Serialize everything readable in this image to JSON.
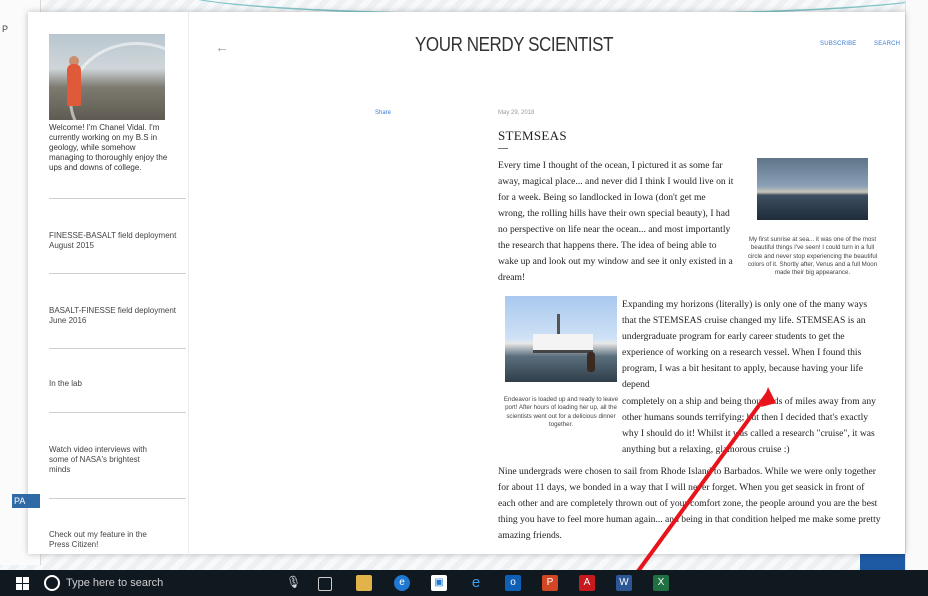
{
  "site": {
    "title": "YOUR NERDY SCIENTIST",
    "back_arrow": "←",
    "subscribe": "SUBSCRIBE",
    "search": "SEARCH"
  },
  "sidebar": {
    "welcome": "Welcome! I'm Chanel Vidal. I'm currently working on my B.S in geology, while somehow managing to thoroughly enjoy the ups and downs of college.",
    "links": [
      "FINESSE-BASALT field deployment August 2015",
      "BASALT-FINESSE field deployment June 2016",
      "In the lab",
      "Watch video interviews with some of NASA's brightest minds",
      "Check out my feature in the Press Citizen!"
    ]
  },
  "post": {
    "share": "Share",
    "date": "May 29, 2018",
    "title": "STEMSEAS",
    "para1": "Every time I thought of the ocean, I pictured it as some far away, magical place... and never did I think I would live on it for a week. Being so landlocked in Iowa (don't get me wrong, the rolling hills have their own special beauty), I had no perspective on life near the ocean... and most importantly the research that happens there. The idea of being able to wake up and look out my window and see it only existed in a dream!",
    "caption1": "My first sunrise at sea... it was one of the most beautiful things I've seen! I could turn in a full circle and never stop experiencing the beautiful colors of it. Shortly after, Venus and a full Moon made their big appearance.",
    "para2": "Expanding my horizons (literally) is only one of the many ways that the STEMSEAS cruise changed my life. STEMSEAS is an undergraduate program for early career students to get the experience of working on a research vessel. When I found this program, I was a bit hesitant to apply, because having your life depend",
    "para2b": "completely on a ship and being thousands of miles away from any other humans sounds terrifying; but then I decided that's exactly why I should do it! Whilst it was called a research \"cruise\", it was anything but a relaxing, glamorous cruise :)",
    "caption2": "Endeavor is loaded up and ready to leave port! After hours of loading her up, all the scientists went out for a delicious dinner together.",
    "para3": "Nine undergrads were chosen to sail from Rhode Island to Barbados. While we were only together for about 11 days, we bonded in a way that I will never forget. When you get seasick in front of each other and are completely thrown out of your comfort zone, the people around you are the best thing you have to feel more human again... and being in that condition helped me make some pretty amazing friends."
  },
  "taskbar": {
    "search_placeholder": "Type here to search",
    "apps": [
      "task-view",
      "file-explorer",
      "edge",
      "store",
      "internet-explorer",
      "outlook",
      "powerpoint",
      "acrobat",
      "word",
      "excel"
    ]
  },
  "colors": {
    "link": "#3a7bd5",
    "taskbar": "#101820",
    "annotation": "#e8141b"
  }
}
